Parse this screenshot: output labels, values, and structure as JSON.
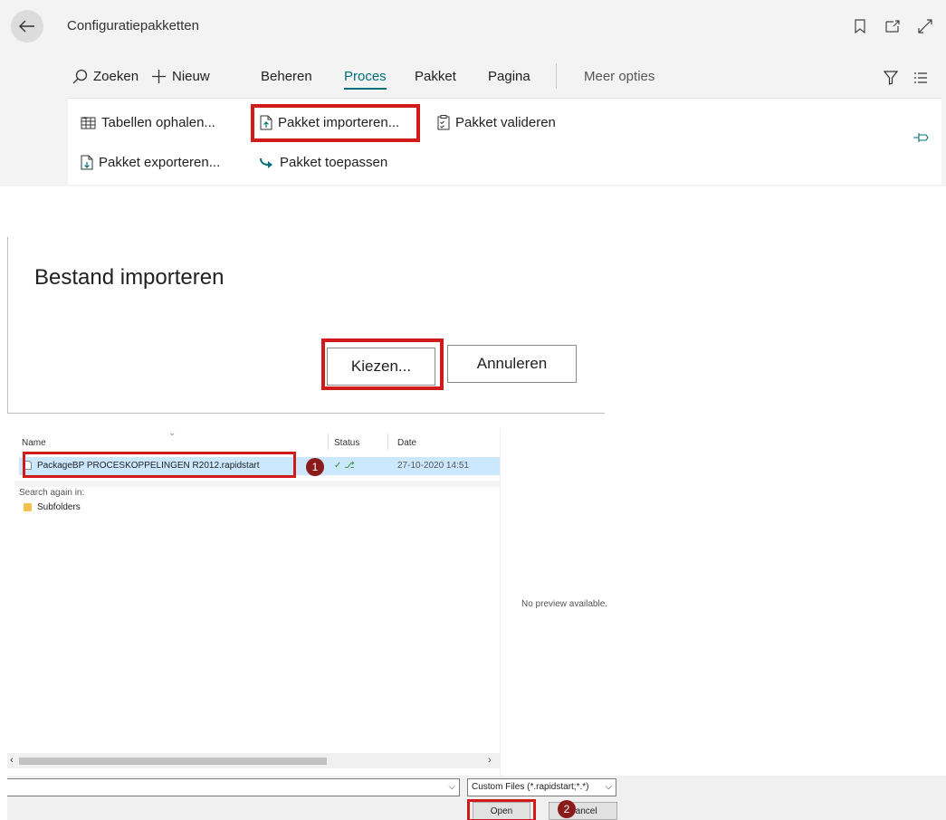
{
  "header": {
    "back_icon": "arrow-left-icon",
    "title": "Configuratiepakketten",
    "icons": [
      "bookmark-icon",
      "open-new-window-icon",
      "expand-icon"
    ]
  },
  "action_bar": {
    "search": "Zoeken",
    "new": "Nieuw",
    "manage": "Beheren",
    "process": "Proces",
    "package": "Pakket",
    "page": "Pagina",
    "more": "Meer opties",
    "filter_icon": "filter-icon",
    "list_icon": "list-view-icon"
  },
  "process_menu": {
    "get_tables": "Tabellen ophalen...",
    "import_package": "Pakket importeren...",
    "validate_package": "Pakket valideren",
    "export_package": "Pakket exporteren...",
    "apply_package": "Pakket toepassen",
    "pin_icon": "pin-icon"
  },
  "import_dialog": {
    "title": "Bestand importeren",
    "choose_button": "Kiezen...",
    "cancel_button": "Annuleren"
  },
  "file_dialog": {
    "columns": {
      "name": "Name",
      "status": "Status",
      "date": "Date"
    },
    "file": {
      "name": "PackageBP PROCESKOPPELINGEN R2012.rapidstart",
      "status": "✓ ⎇",
      "date": "27-10-2020 14:51"
    },
    "search_again": "Search again in:",
    "subfolders": "Subfolders",
    "no_preview": "No preview available.",
    "filter": "Custom Files (*.rapidstart;*.*)",
    "open_button": "Open",
    "cancel_button": "Cancel"
  },
  "annotations": {
    "step1": "1",
    "step2": "2"
  },
  "colors": {
    "accent": "#00707a",
    "highlight": "#d11a1a",
    "badge": "#8b1a1a",
    "selection": "#cce8ff"
  }
}
